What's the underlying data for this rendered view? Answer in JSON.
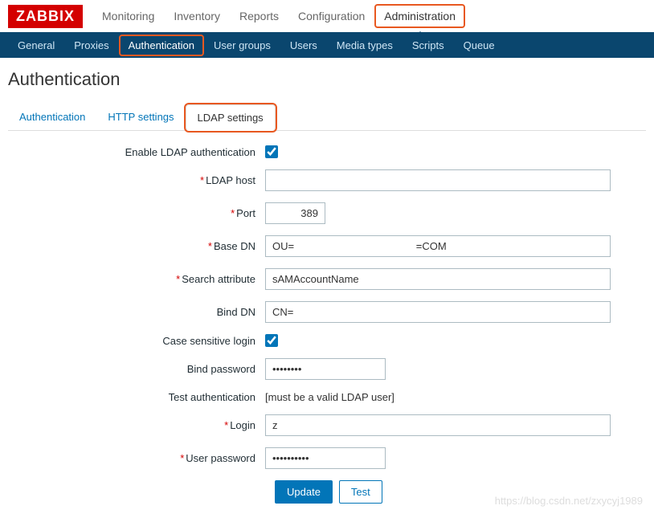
{
  "logo": "ZABBIX",
  "topnav": {
    "items": [
      "Monitoring",
      "Inventory",
      "Reports",
      "Configuration",
      "Administration"
    ],
    "active": 4
  },
  "subnav": {
    "items": [
      "General",
      "Proxies",
      "Authentication",
      "User groups",
      "Users",
      "Media types",
      "Scripts",
      "Queue"
    ],
    "active": 2
  },
  "page_title": "Authentication",
  "tabs": {
    "items": [
      "Authentication",
      "HTTP settings",
      "LDAP settings"
    ],
    "active": 2
  },
  "form": {
    "enable_ldap": {
      "label": "Enable LDAP authentication",
      "checked": true
    },
    "ldap_host": {
      "label": "LDAP host",
      "value": "",
      "required": true
    },
    "port": {
      "label": "Port",
      "value": "389",
      "required": true
    },
    "base_dn": {
      "label": "Base DN",
      "value": "OU=                                          =COM",
      "required": true
    },
    "search_attr": {
      "label": "Search attribute",
      "value": "sAMAccountName",
      "required": true
    },
    "bind_dn": {
      "label": "Bind DN",
      "value": "CN="
    },
    "case_sensitive": {
      "label": "Case sensitive login",
      "checked": true
    },
    "bind_password": {
      "label": "Bind password",
      "value": "••••••••"
    },
    "test_auth": {
      "label": "Test authentication",
      "text": "[must be a valid LDAP user]"
    },
    "login": {
      "label": "Login",
      "value": "z",
      "required": true
    },
    "user_password": {
      "label": "User password",
      "value": "••••••••••",
      "required": true
    }
  },
  "buttons": {
    "update": "Update",
    "test": "Test"
  },
  "watermark": "https://blog.csdn.net/zxycyj1989"
}
